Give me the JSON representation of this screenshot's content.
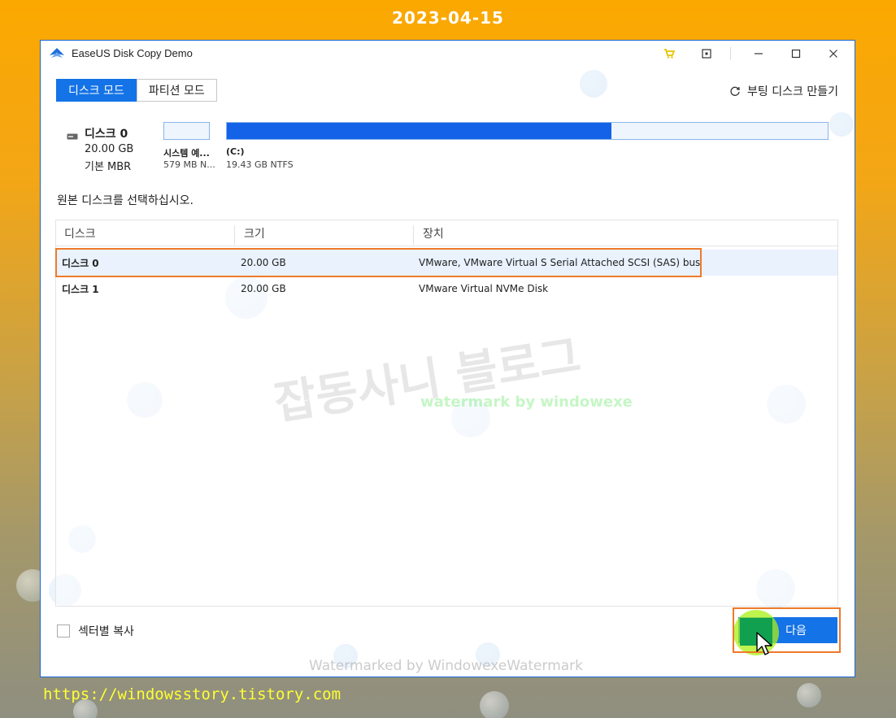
{
  "header": {
    "date": "2023-04-15"
  },
  "footer": {
    "url": "https://windowsstory.tistory.com"
  },
  "window": {
    "title": "EaseUS Disk Copy Demo",
    "accent_color": "#1473e6",
    "highlight_color": "#ef7a2a"
  },
  "tabs": [
    {
      "label": "디스크 모드",
      "active": true
    },
    {
      "label": "파티션 모드",
      "active": false
    }
  ],
  "boot_disk": {
    "label": "부팅 디스크 만들기"
  },
  "disk_summary": {
    "name": "디스크 0",
    "size": "20.00 GB",
    "type": "기본 MBR",
    "partitions": [
      {
        "label": "시스템 예...",
        "detail": "579 MB N...",
        "fill": 0.0
      },
      {
        "label": "(C:)",
        "detail": "19.43 GB NTFS",
        "fill": 0.64
      }
    ]
  },
  "instruction": "원본 디스크를 선택하십시오.",
  "table": {
    "columns": [
      "디스크",
      "크기",
      "장치"
    ],
    "rows": [
      {
        "name": "디스크 0",
        "size": "20.00 GB",
        "device": "VMware,  VMware Virtual S Serial Attached SCSI (SAS) bus",
        "selected": true
      },
      {
        "name": "디스크 1",
        "size": "20.00 GB",
        "device": "VMware Virtual NVMe Disk",
        "selected": false
      }
    ]
  },
  "sector_copy": {
    "label": "섹터별 복사",
    "checked": false
  },
  "next_button": {
    "label": "다음"
  },
  "watermarks": {
    "korean": "잡동사니 블로그",
    "english": "watermark by windowexe",
    "bottom": "Watermarked by WindowexeWatermark"
  }
}
